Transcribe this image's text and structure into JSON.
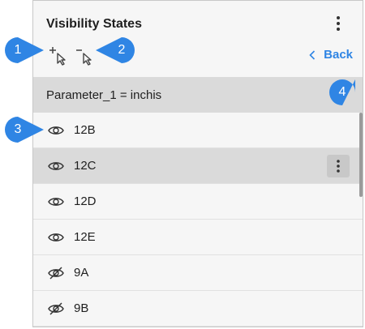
{
  "panel": {
    "title": "Visibility States",
    "back_label": "Back",
    "parameter_label": "Parameter_1 = inchis"
  },
  "states": [
    {
      "label": "12B",
      "visible": true,
      "selected": false
    },
    {
      "label": "12C",
      "visible": true,
      "selected": true
    },
    {
      "label": "12D",
      "visible": true,
      "selected": false
    },
    {
      "label": "12E",
      "visible": true,
      "selected": false
    },
    {
      "label": "9A",
      "visible": false,
      "selected": false
    },
    {
      "label": "9B",
      "visible": false,
      "selected": false
    }
  ],
  "callouts": [
    "1",
    "2",
    "3",
    "4"
  ],
  "colors": {
    "accent": "#2f85e4",
    "callout": "#2f85e4",
    "selected_row": "#dadada",
    "panel_bg": "#f6f6f6"
  },
  "icons": {
    "menu": "vertical-ellipsis-icon",
    "add": "add-pointer-icon",
    "remove": "remove-pointer-icon",
    "back": "chevron-left-icon",
    "visible": "eye-icon",
    "hidden": "eye-off-icon"
  }
}
